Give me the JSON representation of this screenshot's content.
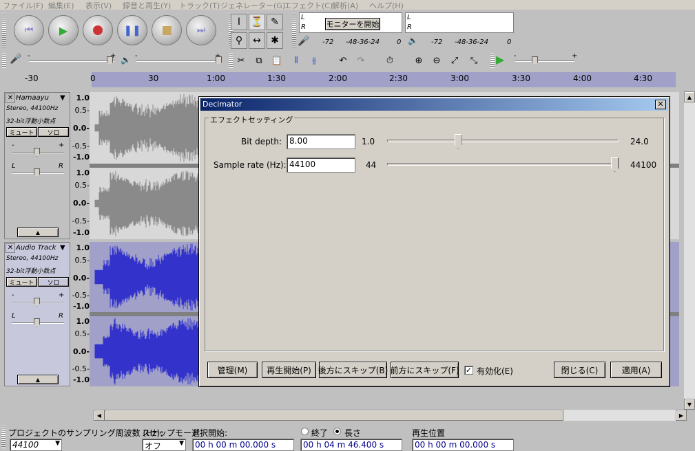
{
  "menu": [
    "ファイル(F)",
    "編集(E)",
    "表示(V)",
    "録音と再生(Y)",
    "トラック(T)",
    "ジェネレーター(G)",
    "エフェクト(C)",
    "解析(A)",
    "ヘルプ(H)"
  ],
  "meter": {
    "rec_L": "L",
    "rec_R": "R",
    "play_L": "L",
    "play_R": "R",
    "monitor_button": "モニターを開始",
    "rec_scale": [
      "-72",
      "-48-36-24",
      "0"
    ],
    "play_scale": [
      "-72",
      "-48-36-24",
      "0"
    ]
  },
  "mixer": {
    "minus": "-",
    "plus": "+"
  },
  "ruler": {
    "ticks": [
      "-30",
      "0",
      "30",
      "1:00",
      "1:30",
      "2:00",
      "2:30",
      "3:00",
      "3:30",
      "4:00",
      "4:30"
    ]
  },
  "tracks": [
    {
      "name": "Hamaayu",
      "info1": "Stereo, 44100Hz",
      "info2": "32-bit浮動小数点",
      "mute": "ミュート",
      "solo": "ソロ",
      "gain_minus": "-",
      "gain_plus": "+",
      "pan_l": "L",
      "pan_r": "R",
      "selected": false,
      "scale": [
        "1.0",
        "0.5-",
        "0.0-",
        "-0.5-",
        "-1.0",
        "1.0",
        "0.5-",
        "0.0-",
        "-0.5-",
        "-1.0"
      ]
    },
    {
      "name": "Audio Track",
      "info1": "Stereo, 44100Hz",
      "info2": "32-bit浮動小数点",
      "mute": "ミュート",
      "solo": "ソロ",
      "gain_minus": "-",
      "gain_plus": "+",
      "pan_l": "L",
      "pan_r": "R",
      "selected": true,
      "scale": [
        "1.0",
        "0.5-",
        "0.0-",
        "-0.5-",
        "-1.0",
        "1.0",
        "0.5-",
        "0.0-",
        "-0.5-",
        "-1.0"
      ]
    }
  ],
  "dialog": {
    "title": "Decimator",
    "close": "✕",
    "group_label": "エフェクトセッティング",
    "bit_depth": {
      "label": "Bit depth:",
      "value": "8.00",
      "min": "1.0",
      "max": "24.0",
      "level": 0.3
    },
    "sample_rate": {
      "label": "Sample rate (Hz):",
      "value": "44100",
      "min": "44",
      "max": "44100",
      "level": 1.0
    },
    "buttons": {
      "manage": "管理(M)",
      "preview": "再生開始(P)",
      "skip_back": "後方にスキップ(B)",
      "skip_fwd": "前方にスキップ(F)",
      "enable": "有効化(E)",
      "close": "閉じる(C)",
      "apply": "適用(A)"
    },
    "enable_checked": true
  },
  "status": {
    "rate_label": "プロジェクトのサンプリング周波数 (Hz):",
    "rate_value": "44100",
    "snap_label": "スナップモード",
    "snap_value": "オフ",
    "sel_start_label": "選択開始:",
    "end_label": "終了",
    "length_label": "長さ",
    "position_label": "再生位置",
    "sel_start_value": "00 h 00 m 00.000 s",
    "length_value": "00 h 04 m 46.400 s",
    "position_value": "00 h 00 m 00.000 s"
  },
  "colors": {
    "wave_gray": "#8a8a8a",
    "wave_blue": "#3333cc",
    "wave_bg_gray": "#c0c0c0",
    "wave_bg_sel": "#a0a0c8",
    "dialog_title": "#0a246a"
  }
}
